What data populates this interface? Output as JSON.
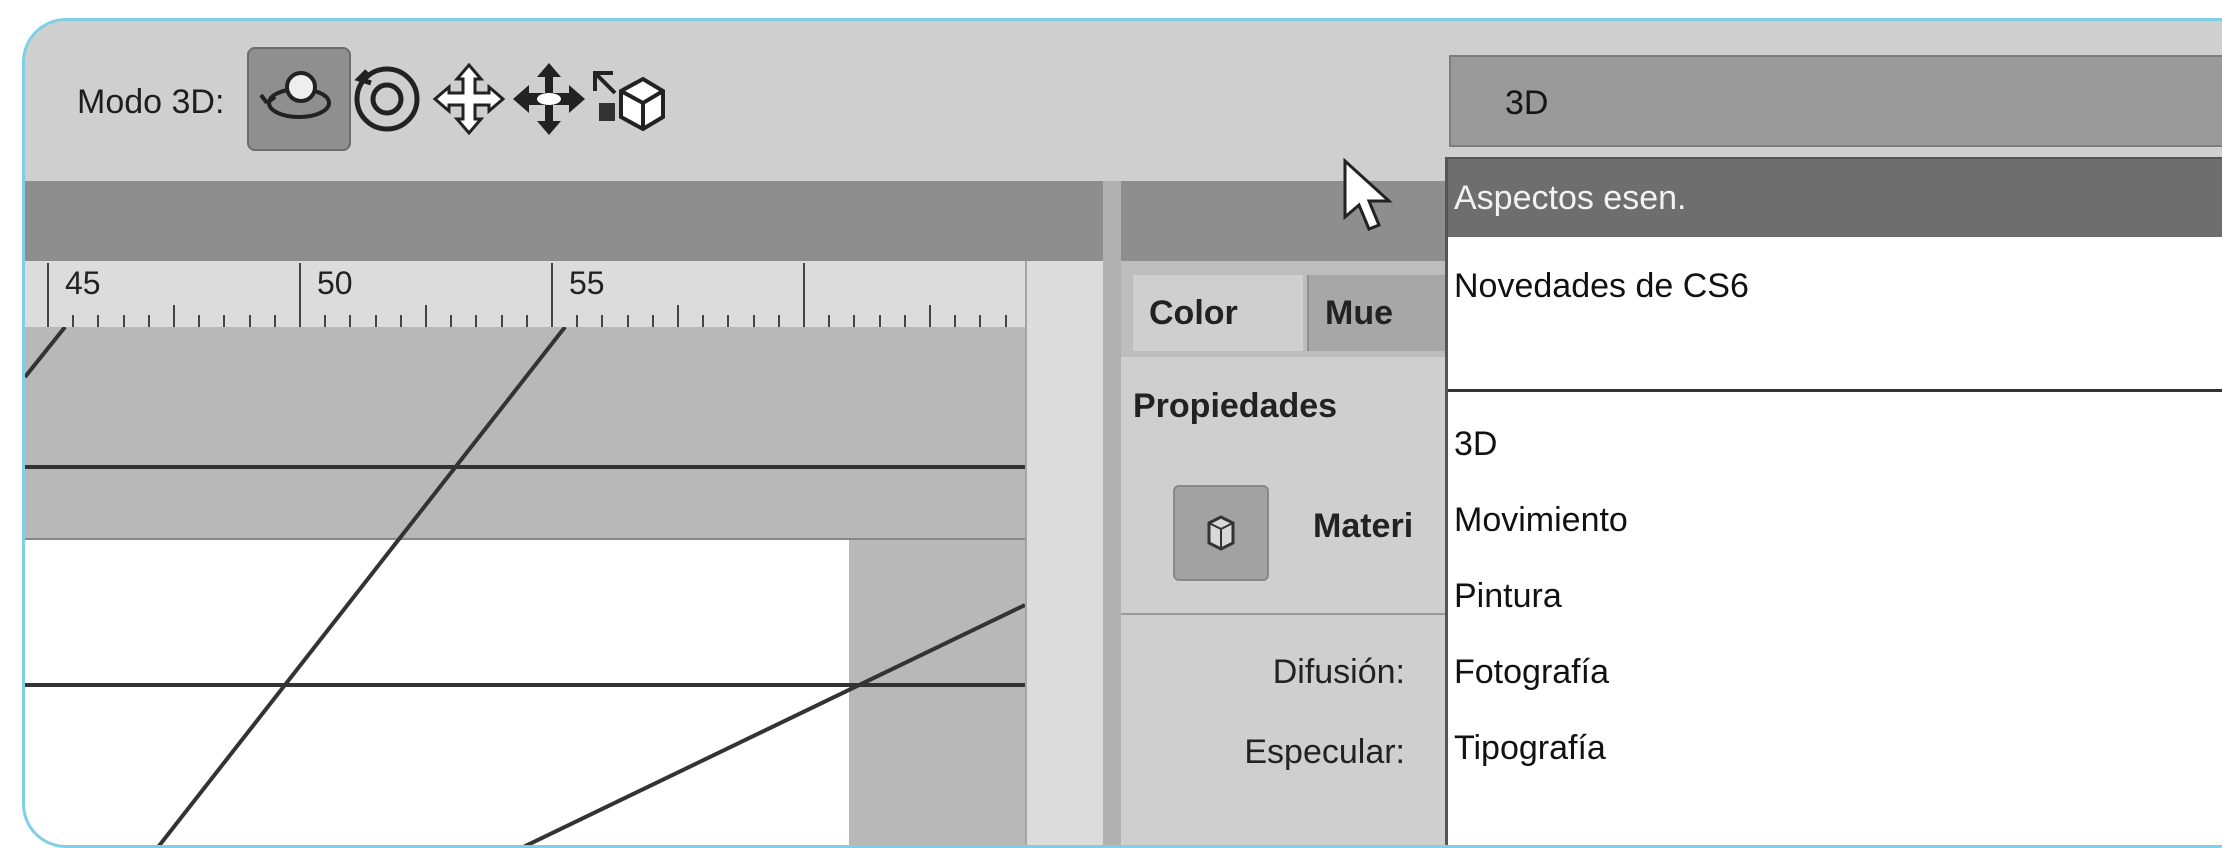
{
  "toolbar": {
    "mode_label": "Modo 3D:",
    "tools": [
      {
        "icon": "orbit-3d-icon",
        "active": true
      },
      {
        "icon": "roll-3d-icon",
        "active": false
      },
      {
        "icon": "drag-3d-icon",
        "active": false
      },
      {
        "icon": "slide-3d-icon",
        "active": false
      },
      {
        "icon": "scale-3d-icon",
        "active": false
      }
    ],
    "workspace_select": {
      "value": "3D",
      "arrows": "⬍"
    }
  },
  "ruler": {
    "labels": [
      "45",
      "50",
      "55"
    ]
  },
  "panel": {
    "tabs": [
      "Color",
      "Mue"
    ],
    "title": "Propiedades",
    "material_label": "Materi",
    "properties": [
      "Difusión:",
      "Especular:"
    ]
  },
  "dropdown": {
    "highlighted": "Aspectos esen.",
    "items_top": [
      "Novedades de CS6"
    ],
    "items_bottom": [
      "3D",
      "Movimiento",
      "Pintura",
      "Fotografía",
      "Tipografía"
    ]
  },
  "colors": {
    "frame_border": "#7fd0e6",
    "highlight": "#6e6e6e"
  }
}
